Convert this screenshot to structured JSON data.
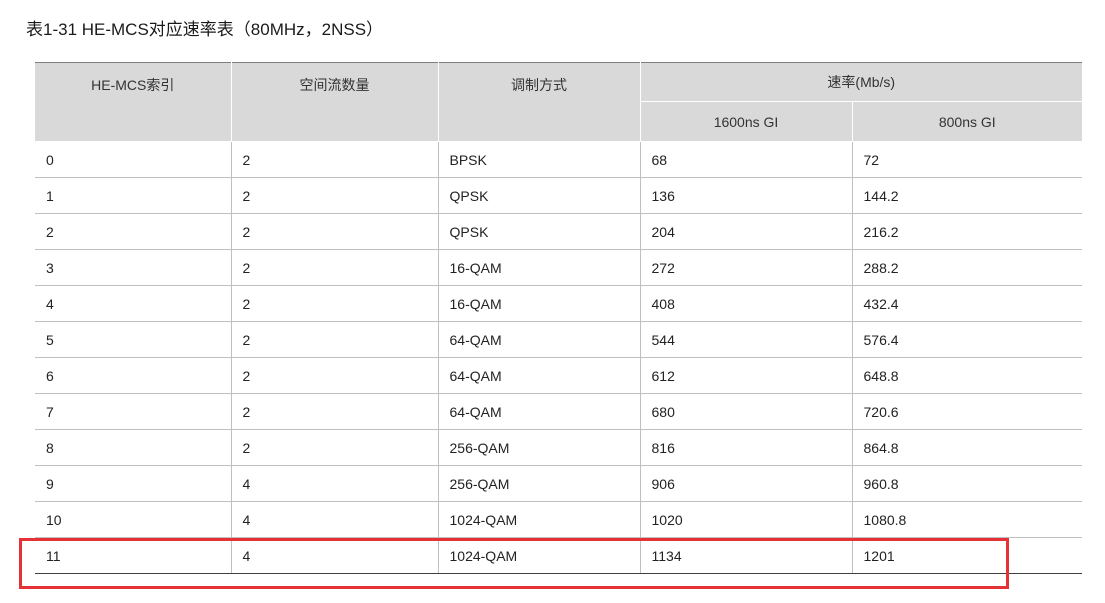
{
  "caption": "表1-31 HE-MCS对应速率表（80MHz，2NSS）",
  "table": {
    "headers": {
      "mcs_index": "HE-MCS索引",
      "spatial_streams": "空间流数量",
      "modulation": "调制方式",
      "rate_group": "速率(Mb/s)",
      "gi_1600": "1600ns GI",
      "gi_800": "800ns GI"
    },
    "rows": [
      [
        "0",
        "2",
        "BPSK",
        "68",
        "72"
      ],
      [
        "1",
        "2",
        "QPSK",
        "136",
        "144.2"
      ],
      [
        "2",
        "2",
        "QPSK",
        "204",
        "216.2"
      ],
      [
        "3",
        "2",
        "16-QAM",
        "272",
        "288.2"
      ],
      [
        "4",
        "2",
        "16-QAM",
        "408",
        "432.4"
      ],
      [
        "5",
        "2",
        "64-QAM",
        "544",
        "576.4"
      ],
      [
        "6",
        "2",
        "64-QAM",
        "612",
        "648.8"
      ],
      [
        "7",
        "2",
        "64-QAM",
        "680",
        "720.6"
      ],
      [
        "8",
        "2",
        "256-QAM",
        "816",
        "864.8"
      ],
      [
        "9",
        "4",
        "256-QAM",
        "906",
        "960.8"
      ],
      [
        "10",
        "4",
        "1024-QAM",
        "1020",
        "1080.8"
      ],
      [
        "11",
        "4",
        "1024-QAM",
        "1134",
        "1201"
      ]
    ]
  },
  "colors": {
    "header_bg": "#d9d9d9",
    "highlight": "#e53238",
    "grid": "#bfbfbf"
  }
}
